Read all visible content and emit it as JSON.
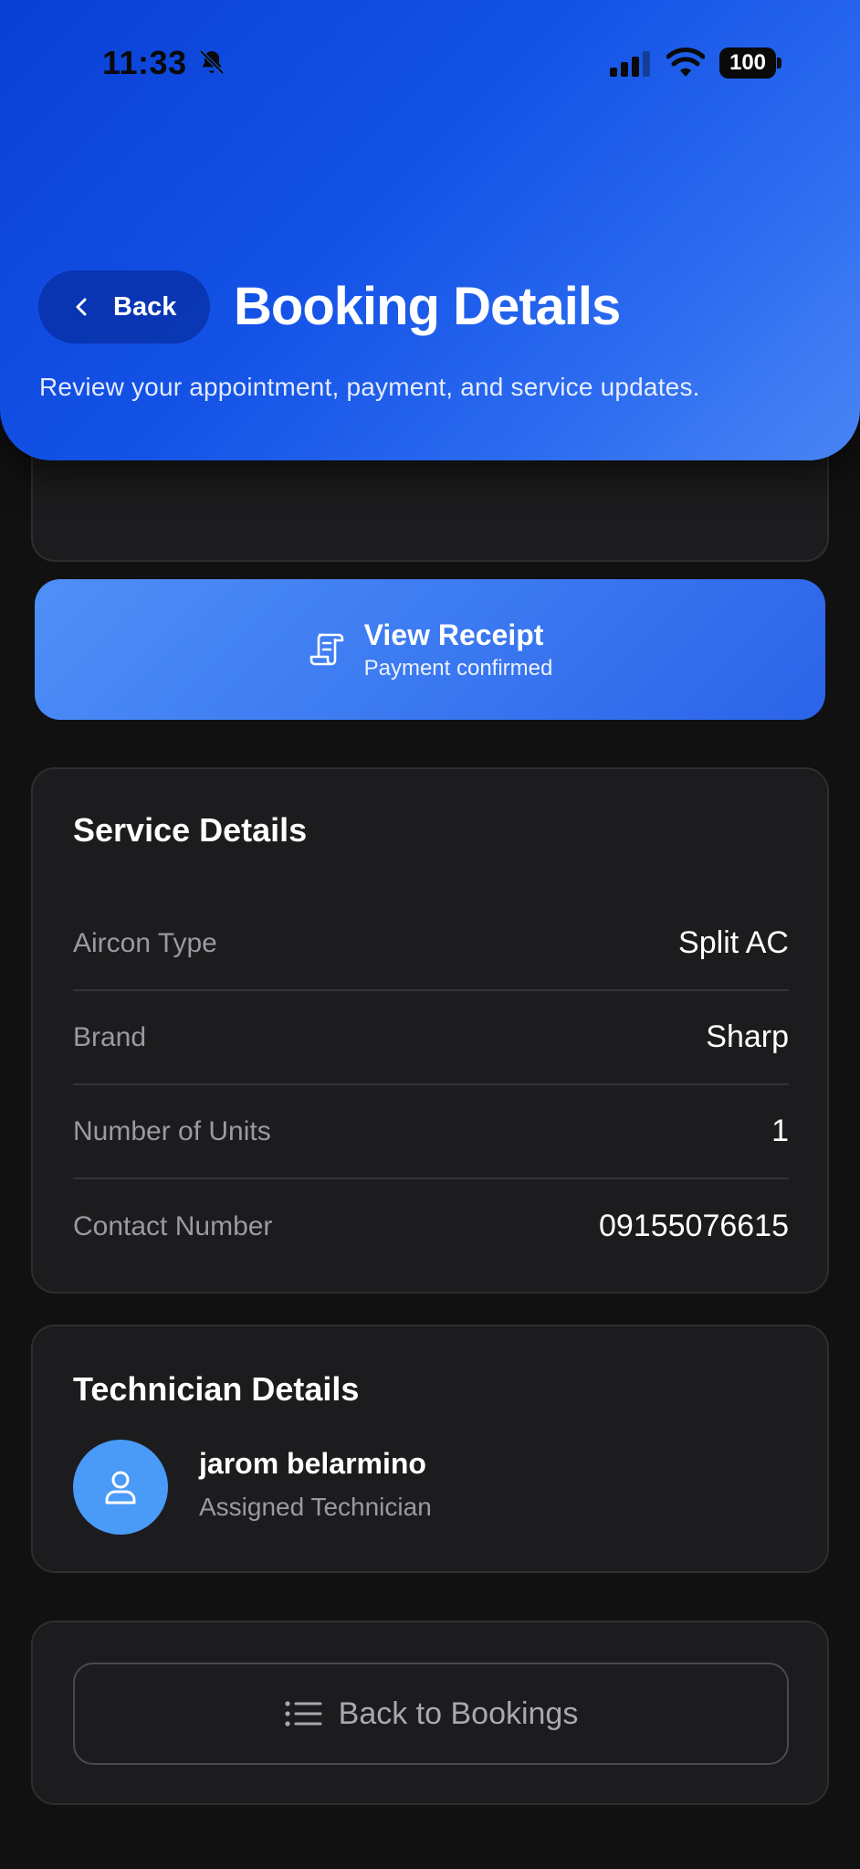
{
  "status_bar": {
    "time": "11:33",
    "battery": "100",
    "icons": [
      "bell-slash-icon",
      "signal-icon",
      "wifi-icon",
      "battery-icon"
    ]
  },
  "header": {
    "back_label": "Back",
    "title": "Booking Details",
    "subtitle": "Review your appointment, payment, and service updates.",
    "gradient_colors": [
      "#0a3fd6",
      "#4a85f5"
    ]
  },
  "receipt": {
    "title": "View Receipt",
    "subtitle": "Payment confirmed",
    "icon": "receipt-icon",
    "color": "#3a78f0"
  },
  "service_details": {
    "title": "Service Details",
    "rows": [
      {
        "label": "Aircon Type",
        "value": "Split AC"
      },
      {
        "label": "Brand",
        "value": "Sharp"
      },
      {
        "label": "Number of Units",
        "value": "1"
      },
      {
        "label": "Contact Number",
        "value": "09155076615"
      }
    ]
  },
  "technician": {
    "title": "Technician Details",
    "name": "jarom belarmino",
    "role": "Assigned Technician",
    "avatar_color": "#4a9af7"
  },
  "footer": {
    "back_to_bookings_label": "Back to Bookings",
    "icon": "list-icon"
  }
}
